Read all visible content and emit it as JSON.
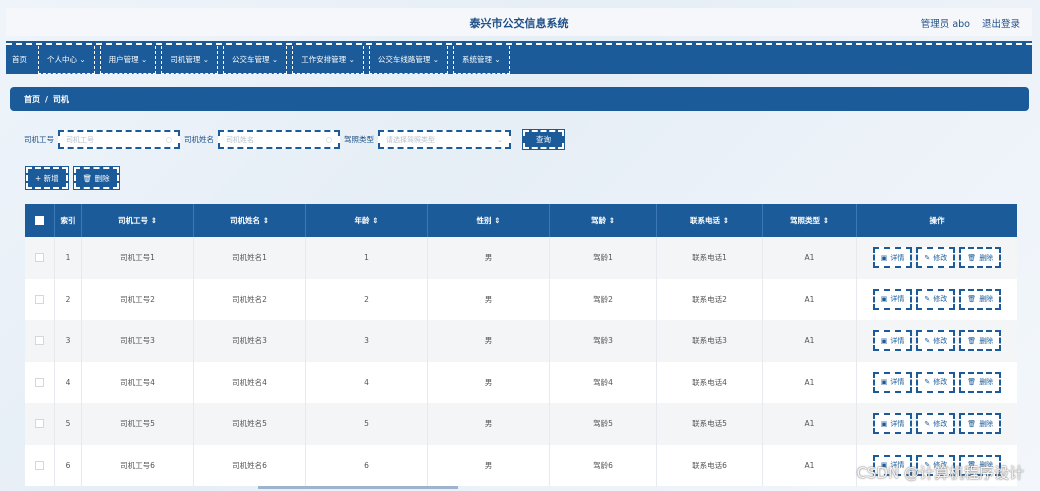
{
  "header": {
    "title": "泰兴市公交信息系统",
    "user_label": "管理员 abo",
    "logout_label": "退出登录"
  },
  "nav": {
    "items": [
      {
        "label": "首页"
      },
      {
        "label": "个人中心 ⌄"
      },
      {
        "label": "用户管理 ⌄"
      },
      {
        "label": "司机管理 ⌄"
      },
      {
        "label": "公交车管理 ⌄"
      },
      {
        "label": "工作安排管理 ⌄"
      },
      {
        "label": "公交车线路管理 ⌄"
      },
      {
        "label": "系统管理 ⌄"
      }
    ]
  },
  "breadcrumb": {
    "home": "首页",
    "sep": "/",
    "current": "司机"
  },
  "search": {
    "id_label": "司机工号",
    "id_placeholder": "司机工号",
    "name_label": "司机姓名",
    "name_placeholder": "司机姓名",
    "type_label": "驾照类型",
    "type_placeholder": "请选择驾照类型",
    "query_label": "查询"
  },
  "actions": {
    "add_label": "+ 新增",
    "delete_label": "🗑 删除"
  },
  "table": {
    "headers": {
      "index": "索引",
      "id": "司机工号 ⇕",
      "name": "司机姓名 ⇕",
      "age": "年龄 ⇕",
      "sex": "性别 ⇕",
      "driving_age": "驾龄 ⇕",
      "phone": "联系电话 ⇕",
      "license": "驾照类型 ⇕",
      "ops": "操作"
    },
    "ops": {
      "detail": "详情",
      "edit": "修改",
      "delete": "删除"
    },
    "rows": [
      {
        "index": "1",
        "id": "司机工号1",
        "name": "司机姓名1",
        "age": "1",
        "sex": "男",
        "driving_age": "驾龄1",
        "phone": "联系电话1",
        "license": "A1"
      },
      {
        "index": "2",
        "id": "司机工号2",
        "name": "司机姓名2",
        "age": "2",
        "sex": "男",
        "driving_age": "驾龄2",
        "phone": "联系电话2",
        "license": "A1"
      },
      {
        "index": "3",
        "id": "司机工号3",
        "name": "司机姓名3",
        "age": "3",
        "sex": "男",
        "driving_age": "驾龄3",
        "phone": "联系电话3",
        "license": "A1"
      },
      {
        "index": "4",
        "id": "司机工号4",
        "name": "司机姓名4",
        "age": "4",
        "sex": "男",
        "driving_age": "驾龄4",
        "phone": "联系电话4",
        "license": "A1"
      },
      {
        "index": "5",
        "id": "司机工号5",
        "name": "司机姓名5",
        "age": "5",
        "sex": "男",
        "driving_age": "驾龄5",
        "phone": "联系电话5",
        "license": "A1"
      },
      {
        "index": "6",
        "id": "司机工号6",
        "name": "司机姓名6",
        "age": "6",
        "sex": "男",
        "driving_age": "驾龄6",
        "phone": "联系电话6",
        "license": "A1"
      }
    ]
  },
  "watermark": "CSDN @计算机程序设计",
  "colors": {
    "primary": "#1b5b9a",
    "title": "#1f4f86"
  }
}
